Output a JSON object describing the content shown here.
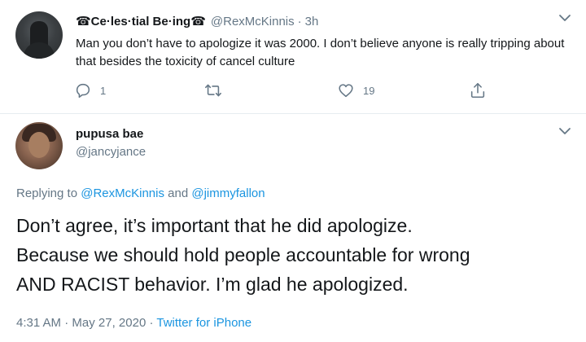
{
  "reply": {
    "display_name": "☎Ce·les·tial Be·ing☎",
    "handle": "@RexMcKinnis",
    "separator": "·",
    "time": "3h",
    "text": "Man you don’t have to apologize it was 2000. I don’t believe anyone is really tripping about that besides the toxicity of cancel culture",
    "actions": {
      "reply_count": "1",
      "retweet_count": "",
      "like_count": "19"
    }
  },
  "main": {
    "display_name": "pupusa bae",
    "handle": "@jancyjance",
    "replying_prefix": "Replying to",
    "mention_1": "@RexMcKinnis",
    "and": "and",
    "mention_2": "@jimmyfallon",
    "text_line_1": "Don’t agree, it’s important that he did apologize.",
    "text_line_2": "Because we should hold people accountable for wrong",
    "text_line_3": "AND RACIST behavior. I’m glad he apologized.",
    "time": "4:31 AM",
    "date": "May 27, 2020",
    "separator": "·",
    "source": "Twitter for iPhone"
  },
  "icons": {
    "reply": "reply-icon",
    "retweet": "retweet-icon",
    "like": "heart-icon",
    "share": "share-icon",
    "menu": "chevron-down-icon"
  },
  "colors": {
    "link": "#1b95e0",
    "secondary": "#657786",
    "text": "#14171a"
  }
}
